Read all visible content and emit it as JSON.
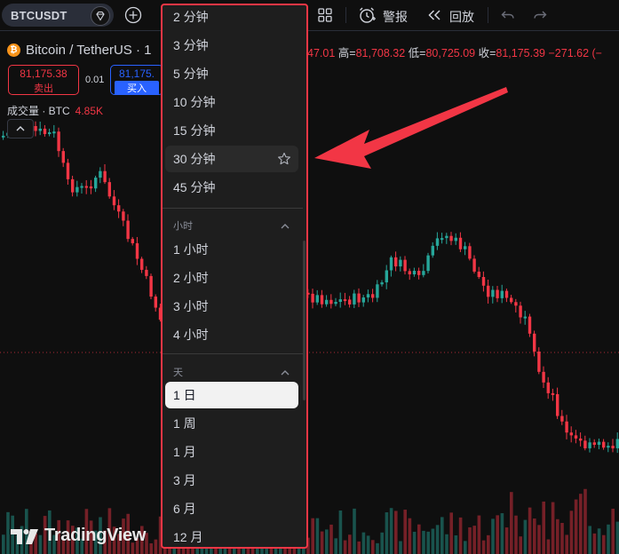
{
  "toolbar": {
    "symbol": "BTCUSDT",
    "alert_label": "警报",
    "replay_label": "回放"
  },
  "legend": {
    "coin_glyph": "₿",
    "pair": "Bitcoin / TetherUS · 1",
    "ohlc": {
      "open_partial": "47.01",
      "high_label": "高=",
      "high": "81,708.32",
      "low_label": "低=",
      "low": "80,725.09",
      "close_label": "收=",
      "close": "81,175.39",
      "change": "−271.62 (−"
    },
    "sell": {
      "price": "81,175.38",
      "label": "卖出"
    },
    "spread": "0.01",
    "buy": {
      "price": "81,175.",
      "label": "买入"
    },
    "volume": {
      "label": "成交量 · BTC",
      "value": "4.85K"
    }
  },
  "watermark": "TradingView",
  "dropdown": {
    "minutes": [
      "2 分钟",
      "3 分钟",
      "5 分钟",
      "10 分钟",
      "15 分钟",
      "30 分钟",
      "45 分钟"
    ],
    "hovered_index": 5,
    "hours_header": "小时",
    "hours": [
      "1 小时",
      "2 小时",
      "3 小时",
      "4 小时"
    ],
    "days_header": "天",
    "days": [
      "1 日",
      "1 周",
      "1 月",
      "3 月",
      "6 月",
      "12 月"
    ],
    "selected_day_index": 0
  },
  "colors": {
    "up": "#26a69a",
    "down": "#f23645",
    "highlight_border": "#f23645",
    "annotation_arrow": "#f23645"
  },
  "chart_data": {
    "type": "candlestick",
    "symbol": "BTCUSDT",
    "last_close": 81175.39,
    "high": 81708.32,
    "low": 80725.09
  }
}
